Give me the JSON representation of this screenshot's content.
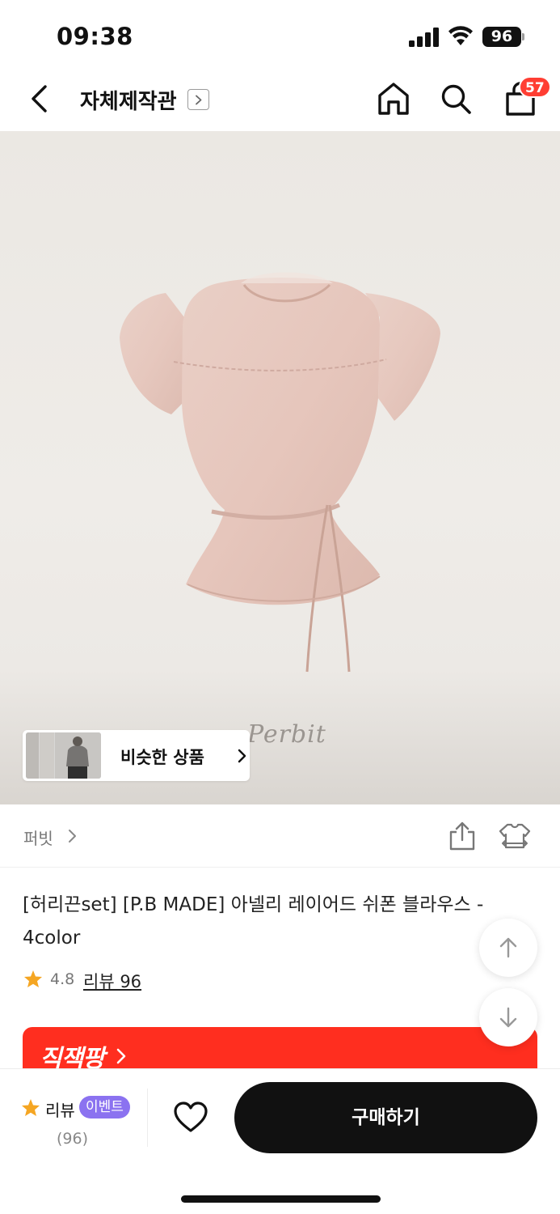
{
  "status_bar": {
    "time": "09:38",
    "battery": "96"
  },
  "nav": {
    "title": "자체제작관",
    "cart_count": "57"
  },
  "hero": {
    "watermark": "Perbit",
    "similar_label": "비슷한 상품"
  },
  "brand": {
    "name": "퍼빗"
  },
  "product": {
    "title": "[허리끈set] [P.B MADE] 아넬리 레이어드 쉬폰 블라우스 - 4color",
    "rating": "4.8",
    "review_link": "리뷰 96"
  },
  "promo": {
    "label": "직잭팡"
  },
  "bottom": {
    "review_label": "리뷰",
    "event_badge": "이벤트",
    "review_count": "(96)",
    "buy_label": "구매하기"
  },
  "colors": {
    "accent_red": "#ff2e1f",
    "badge_purple": "#8b72f0",
    "star": "#f5a623",
    "buy_button": "#111111"
  }
}
